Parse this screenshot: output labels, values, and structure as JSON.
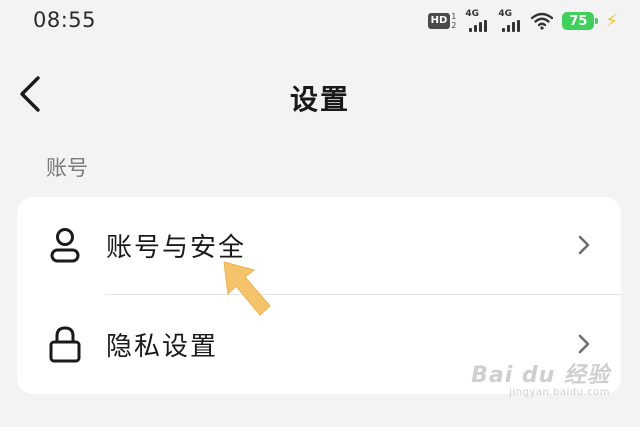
{
  "status_bar": {
    "time": "08:55",
    "hd_label": "HD",
    "hd_sub_top": "1",
    "hd_sub_bottom": "2",
    "signal_1_label": "4G",
    "signal_2_label": "4G",
    "battery_level": "75",
    "battery_color": "#3fd05a",
    "icons": [
      "hd-icon",
      "signal-icon",
      "signal-icon",
      "wifi-icon",
      "battery-icon",
      "charging-bolt-icon"
    ]
  },
  "nav": {
    "back_icon": "chevron-left-icon",
    "title": "设置"
  },
  "section": {
    "header": "账号"
  },
  "settings_items": [
    {
      "label": "账号与安全",
      "icon": "user-icon",
      "chevron": "chevron-right-icon"
    },
    {
      "label": "隐私设置",
      "icon": "lock-icon",
      "chevron": "chevron-right-icon"
    }
  ],
  "annotation": {
    "arrow_color": "#f5c46a"
  },
  "watermark": {
    "main": "Bai du 经验",
    "sub": "jingyan.baidu.com"
  }
}
